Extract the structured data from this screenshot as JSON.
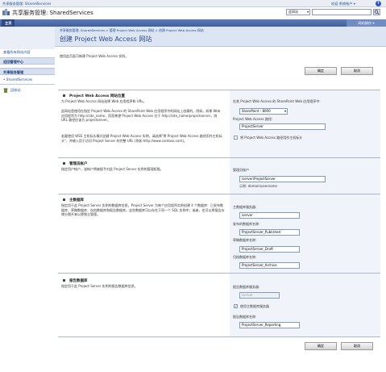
{
  "top": {
    "site_title": "共享服务管理: SharedServices",
    "welcome": "欢迎 系统帐户 ▾",
    "help_icon": "?"
  },
  "header": {
    "title": "共享服务管理: SharedServices",
    "scope_select": "此网站",
    "search_icon": "search-icon"
  },
  "topnav": {
    "home_tab": "主页",
    "site_actions": "网站操作 ▾"
  },
  "sidebar": {
    "view_all": "查看所有网站内容",
    "items": [
      {
        "label": "返回管理中心"
      },
      {
        "label": "共享服务管理"
      },
      {
        "label": "• SharedServices"
      }
    ],
    "recycle_bin": "回收站"
  },
  "breadcrumb": "共享服务管理: SharedServices > 管理 Project Web Access 网站 > 创建 Project Web Access 网站",
  "page_title": "创建 Project Web Access 网站",
  "page_desc": "使用此页面可新建 Project Web Access 实例。",
  "buttons": {
    "ok": "确定",
    "cancel": "取消"
  },
  "sections": {
    "location": {
      "title": "Project Web Access 网站位置",
      "desc1": "为 Project Web Access 网站选择 Web 应用程序和 URL。",
      "desc2": "此网站是使用在指定 Project Web Access 的 SharePoint Web 应用程序中的网站上创建的。例如，如果 Web 应用程序为 http://site_name，而您希望 Project Web Access 位于 http://site_name/projectserver，则 URL 路径应该为 projectserver。",
      "desc3": "若要使用 WSS 主机标头模式创建 Project Web Access 实例，请选择\"将 Project Web Access 路径用作主机标头\"，并输入用于访问 Project Server 的完整 URL (例如 http://www.contoso.com)。",
      "webapp_label": "在其 Project Web Access 的 SharePoint Web 应用程序中:",
      "webapp_value": "SharePoint - 8000",
      "path_label": "Project Web Access 路径:",
      "path_value": "ProjectServer",
      "hostheader_label": "将 Project Web Access 路径用作主机标头"
    },
    "admin": {
      "title": "管理员帐户",
      "desc": "指定用户帐户，该帐户将被赋予对此 Project Server 实例的管理权限。",
      "label": "管理员帐户",
      "value": "iserver\\ProjectServer",
      "example": "示例: domain\\username"
    },
    "primary_db": {
      "title": "主数据库",
      "desc": "指定用于此 Project Server 实例的数据库信息。Project Server 为每个应用程序实例创建 4 个数据库：已发布数据库、草稿数据库、存档数据库和报告数据库。这些数据库可以存在于同一个 SQL 实例中；或者，也可以将报告存储分隔开来以便独立管理。",
      "server_label": "主数据库服务器:",
      "server_value": "iserver",
      "published_label": "发布的数据库名称:",
      "published_value": "ProjectServer_Published",
      "draft_label": "草稿数据库名称:",
      "draft_value": "ProjectServer_Draft",
      "archive_label": "归档数据库名称:",
      "archive_value": "ProjectServer_Archive"
    },
    "reporting_db": {
      "title": "报告数据库",
      "desc": "指定用于此 Project Server 实例的报告数据库信息。",
      "server_label": "报告数据库服务器:",
      "server_value": "iserver",
      "use_primary_label": "使用主数据库服务器",
      "name_label": "报告数据库名称:",
      "name_value": "ProjectServer_Reporting"
    }
  },
  "colors": {
    "accent": "#2b4b8f",
    "nav": "#4a6aa6",
    "panel": "#e8eef8"
  }
}
